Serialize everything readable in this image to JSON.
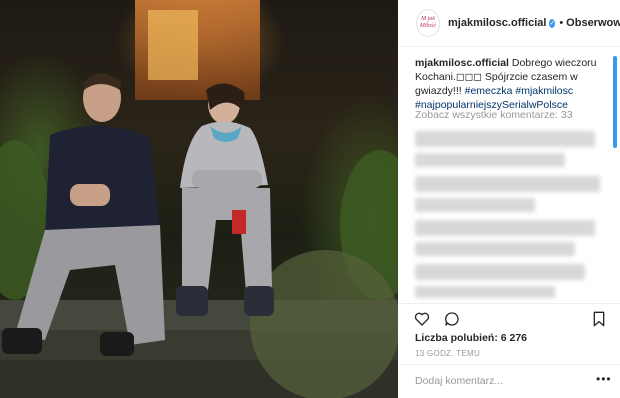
{
  "post": {
    "username": "mjakmilosc.official",
    "follow_label": "Obserwowanie",
    "verified_mark": "✓",
    "separator": "•",
    "avatar_text": "M jak Miłość",
    "caption_username": "mjakmilosc.official",
    "caption_text": "Dobrego wieczoru Kochani.◻◻◻ Spójrzcie czasem w gwiazdy!!!",
    "hashtags": [
      "#emeczka",
      "#mjakmilosc",
      "#najpopularniejszySerialwPolsce"
    ],
    "view_all_comments": "Zobacz wszystkie komentarze: 33",
    "likes": "Liczba polubień: 6 276",
    "time_ago": "13 GODZ. TEMU",
    "comment_placeholder": "Dodaj komentarz...",
    "more_options": "•••"
  },
  "icons": [
    "heart-icon",
    "comment-icon",
    "bookmark-icon",
    "verified-icon"
  ],
  "colors": {
    "link": "#003569",
    "verified": "#3897f0",
    "muted": "#999999",
    "text": "#262626"
  }
}
